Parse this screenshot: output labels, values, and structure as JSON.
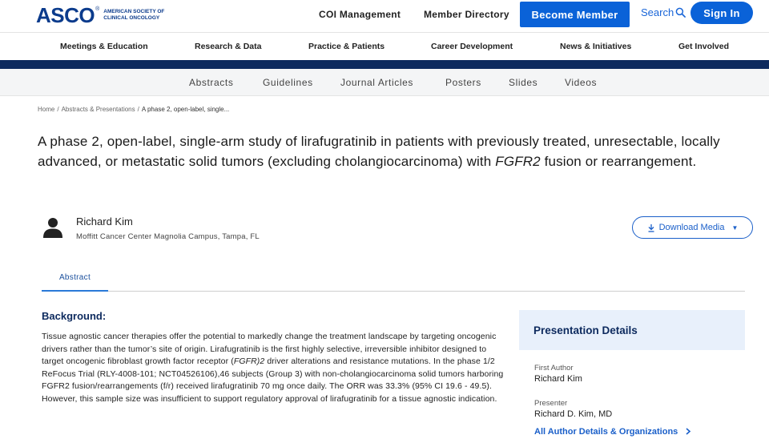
{
  "logo": {
    "word": "ASCO",
    "registered": "®",
    "subline1": "American Society of",
    "subline2": "Clinical Oncology"
  },
  "header": {
    "coi_label": "COI Management",
    "directory_label": "Member Directory",
    "become_member_label": "Become Member",
    "search_label": "Search",
    "signin_label": "Sign In"
  },
  "main_nav": [
    {
      "label": "Meetings & Education"
    },
    {
      "label": "Research & Data"
    },
    {
      "label": "Practice & Patients"
    },
    {
      "label": "Career Development"
    },
    {
      "label": "News & Initiatives"
    },
    {
      "label": "Get Involved"
    }
  ],
  "sub_nav": [
    {
      "label": "Abstracts"
    },
    {
      "label": "Guidelines"
    },
    {
      "label": "Journal Articles"
    },
    {
      "label": "Posters"
    },
    {
      "label": "Slides"
    },
    {
      "label": "Videos"
    }
  ],
  "breadcrumb": {
    "home": "Home",
    "section": "Abstracts & Presentations",
    "current": "A phase 2, open-label, single..."
  },
  "title": {
    "part1": "A phase 2, open-label, single-arm study of lirafugratinib in patients with previously treated, unresectable, locally advanced, or metastatic solid tumors (excluding cholangiocarcinoma) with ",
    "italic": "FGFR2",
    "part2": " fusion or rearrangement."
  },
  "author": {
    "name": "Richard Kim",
    "affiliation": "Moffitt Cancer Center Magnolia Campus, Tampa, FL"
  },
  "download": {
    "label": "Download Media"
  },
  "tabs": {
    "abstract_label": "Abstract"
  },
  "abstract": {
    "heading": "Background:",
    "text_part1": "Tissue agnostic cancer therapies offer the potential to markedly change the treatment landscape by targeting oncogenic drivers rather than the tumor’s site of origin. Lirafugratinib is the first highly selective, irreversible inhibitor designed to target oncogenic fibroblast growth factor receptor (",
    "text_italic": "FGFR)2",
    "text_part2": " driver alterations and resistance mutations. In the phase 1/2 ReFocus Trial (RLY-4008-101; NCT04526106),46 subjects (Group 3) with non-cholangiocarcinoma solid tumors harboring FGFR2 fusion/rearrangements (f/r) received lirafugratinib 70 mg once daily. The ORR was 33.3% (95% CI 19.6 - 49.5). However, this sample size was insufficient to support regulatory approval of lirafugratinib for a tissue agnostic indication."
  },
  "panel": {
    "title": "Presentation Details",
    "first_author_label": "First Author",
    "first_author_value": "Richard Kim",
    "presenter_label": "Presenter",
    "presenter_value": "Richard D. Kim, MD",
    "details_link": "All Author Details & Organizations"
  },
  "colors": {
    "brand_blue": "#0a62d8",
    "navy": "#0d2a5e",
    "link_blue": "#1a5fc9"
  }
}
